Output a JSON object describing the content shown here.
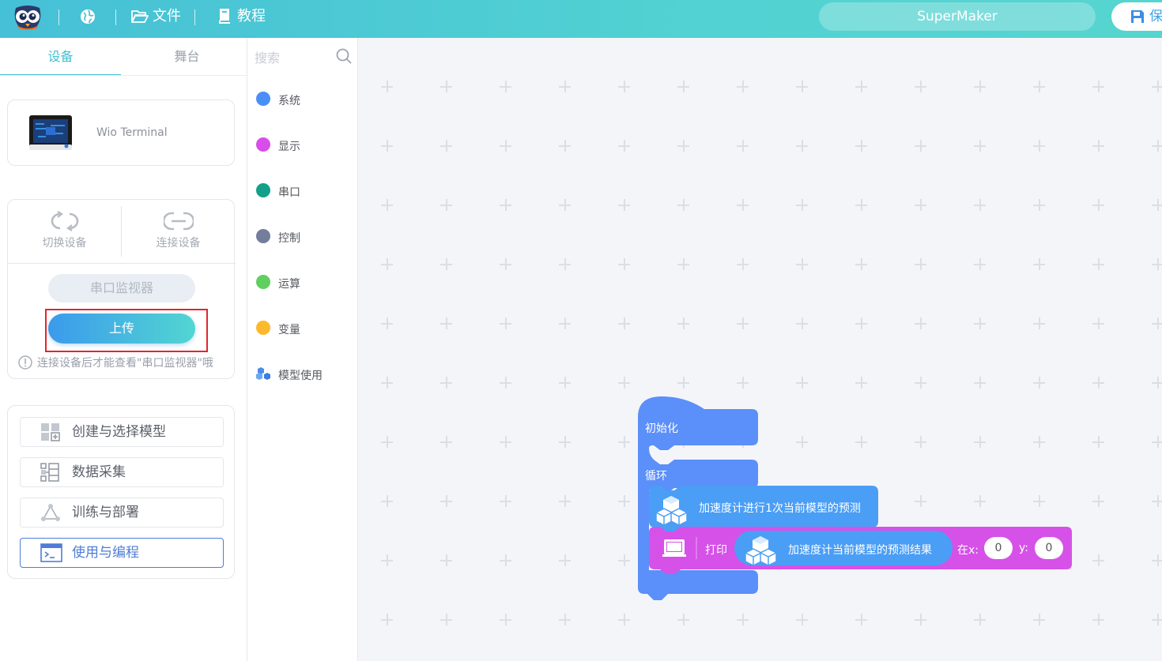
{
  "topbar": {
    "file_label": "文件",
    "tutorial_label": "教程",
    "project_name": "SuperMaker",
    "save_label": "保"
  },
  "left_panel": {
    "tabs": [
      {
        "label": "设备",
        "active": true
      },
      {
        "label": "舞台",
        "active": false
      }
    ],
    "device": {
      "name": "Wio Terminal"
    },
    "switch_device_label": "切换设备",
    "connect_device_label": "连接设备",
    "serial_monitor_label": "串口监视器",
    "upload_label": "上传",
    "hint": "连接设备后才能查看\"串口监视器\"哦",
    "menu": [
      {
        "label": "创建与选择模型",
        "icon": "grid-plus-icon",
        "selected": false
      },
      {
        "label": "数据采集",
        "icon": "data-list-icon",
        "selected": false
      },
      {
        "label": "训练与部署",
        "icon": "triangle-nodes-icon",
        "selected": false
      },
      {
        "label": "使用与编程",
        "icon": "terminal-window-icon",
        "selected": true
      }
    ]
  },
  "categories": {
    "search_placeholder": "搜索",
    "items": [
      {
        "label": "系统",
        "color": "#4c8ef7"
      },
      {
        "label": "显示",
        "color": "#d84ee8"
      },
      {
        "label": "串口",
        "color": "#12a08a"
      },
      {
        "label": "控制",
        "color": "#737d9c"
      },
      {
        "label": "运算",
        "color": "#5fcf5f"
      },
      {
        "label": "变量",
        "color": "#fdb82c"
      },
      {
        "label": "模型使用",
        "color": "#4a8ee8"
      }
    ]
  },
  "blocks": {
    "init_label": "初始化",
    "loop_label": "循环",
    "predict_label": "加速度计进行1次当前模型的预测",
    "print_label": "打印",
    "result_label": "加速度计当前模型的预测结果",
    "at_x_label": "在x:",
    "x_value": "0",
    "y_label": "y:",
    "y_value": "0",
    "colors": {
      "event": "#5b8ff9",
      "display": "#d651e8",
      "model": "#4a9ef5"
    }
  }
}
